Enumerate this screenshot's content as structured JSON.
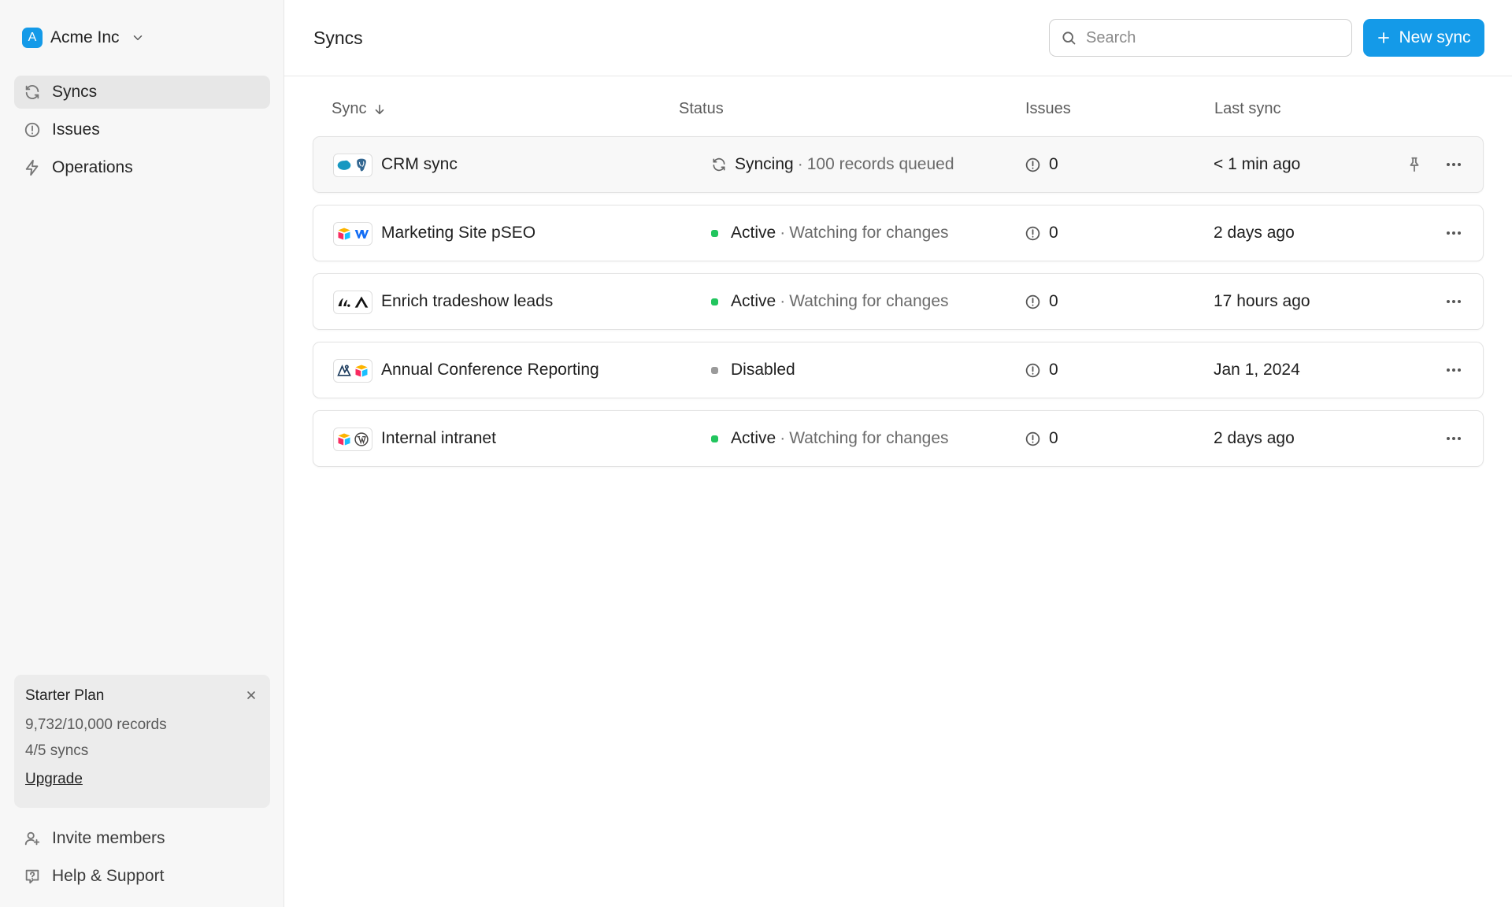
{
  "workspace": {
    "initial": "A",
    "name": "Acme Inc"
  },
  "sidebar": {
    "items": [
      {
        "label": "Syncs",
        "icon": "refresh-icon",
        "active": true
      },
      {
        "label": "Issues",
        "icon": "alert-circle-icon",
        "active": false
      },
      {
        "label": "Operations",
        "icon": "lightning-icon",
        "active": false
      }
    ],
    "plan": {
      "title": "Starter Plan",
      "records": "9,732/10,000 records",
      "syncs": "4/5 syncs",
      "upgrade": "Upgrade"
    },
    "footer": {
      "invite": "Invite members",
      "help": "Help & Support"
    }
  },
  "header": {
    "title": "Syncs",
    "search_placeholder": "Search",
    "new_button": "New sync"
  },
  "table": {
    "columns": {
      "sync": "Sync",
      "status": "Status",
      "issues": "Issues",
      "last_sync": "Last sync"
    },
    "rows": [
      {
        "name": "CRM sync",
        "logos": [
          "salesforce-logo-icon",
          "postgres-logo-icon"
        ],
        "state": "Syncing",
        "separator": "·",
        "detail": "100 records queued",
        "status_kind": "syncing",
        "issues": "0",
        "last_sync": "< 1 min ago"
      },
      {
        "name": "Marketing Site pSEO",
        "logos": [
          "airtable-logo-icon",
          "webflow-logo-icon"
        ],
        "state": "Active",
        "separator": "·",
        "detail": "Watching for changes",
        "status_kind": "active",
        "issues": "0",
        "last_sync": "2 days ago"
      },
      {
        "name": "Enrich tradeshow leads",
        "logos": [
          "clay-logo-icon",
          "attio-logo-icon"
        ],
        "state": "Active",
        "separator": "·",
        "detail": "Watching for changes",
        "status_kind": "active",
        "issues": "0",
        "last_sync": "17 hours ago"
      },
      {
        "name": "Annual Conference Reporting",
        "logos": [
          "eventbrite-logo-icon",
          "airtable-logo-icon"
        ],
        "state": "Disabled",
        "separator": "",
        "detail": "",
        "status_kind": "disabled",
        "issues": "0",
        "last_sync": "Jan 1, 2024"
      },
      {
        "name": "Internal intranet",
        "logos": [
          "airtable-logo-icon",
          "wordpress-logo-icon"
        ],
        "state": "Active",
        "separator": "·",
        "detail": "Watching for changes",
        "status_kind": "active",
        "issues": "0",
        "last_sync": "2 days ago"
      }
    ]
  },
  "colors": {
    "accent": "#149ae8",
    "active_dot": "#22c55e",
    "disabled_dot": "#9a9a9a"
  }
}
